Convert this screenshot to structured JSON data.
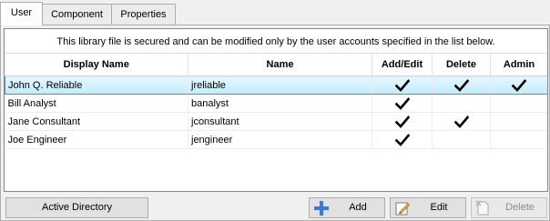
{
  "tabs": [
    {
      "label": "User",
      "active": true
    },
    {
      "label": "Component",
      "active": false
    },
    {
      "label": "Properties",
      "active": false
    }
  ],
  "notice": "This library file is secured and can be modified only by the user accounts specified in the list below.",
  "table": {
    "columns": [
      "Display Name",
      "Name",
      "Add/Edit",
      "Delete",
      "Admin"
    ],
    "rows": [
      {
        "display_name": "John Q. Reliable",
        "name": "jreliable",
        "add_edit": true,
        "delete": true,
        "admin": true,
        "selected": true
      },
      {
        "display_name": "Bill Analyst",
        "name": "banalyst",
        "add_edit": true,
        "delete": false,
        "admin": false,
        "selected": false
      },
      {
        "display_name": "Jane Consultant",
        "name": "jconsultant",
        "add_edit": true,
        "delete": true,
        "admin": false,
        "selected": false
      },
      {
        "display_name": "Joe Engineer",
        "name": "jengineer",
        "add_edit": true,
        "delete": false,
        "admin": false,
        "selected": false
      }
    ]
  },
  "buttons": {
    "active_directory": "Active Directory",
    "add": "Add",
    "edit": "Edit",
    "delete": "Delete"
  },
  "icons": {
    "check": "checkmark-icon",
    "add": "plus-icon",
    "edit": "edit-pencil-icon",
    "delete": "delete-document-icon"
  },
  "colors": {
    "selection_border": "#26a0da",
    "add_icon": "#3a7bd5"
  }
}
